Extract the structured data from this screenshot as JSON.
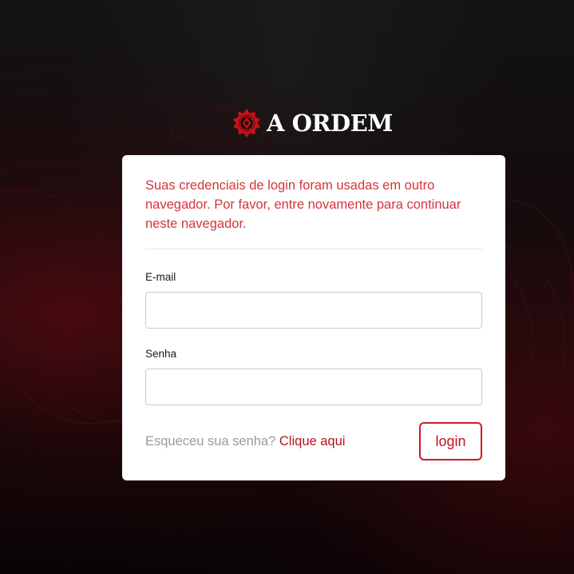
{
  "brand": {
    "name": "A ORDEM",
    "logo_icon": "ornamental-rose-emblem-icon",
    "accent_color": "#c5111a"
  },
  "alert": {
    "message": "Suas credenciais de login foram usadas em outro navegador. Por favor, entre novamente para continuar neste navegador.",
    "color": "#d4353b"
  },
  "form": {
    "email_label": "E-mail",
    "email_value": "",
    "password_label": "Senha",
    "password_value": ""
  },
  "footer": {
    "forgot_text": "Esqueceu sua senha?",
    "forgot_link": "Clique aqui",
    "login_label": "login"
  }
}
